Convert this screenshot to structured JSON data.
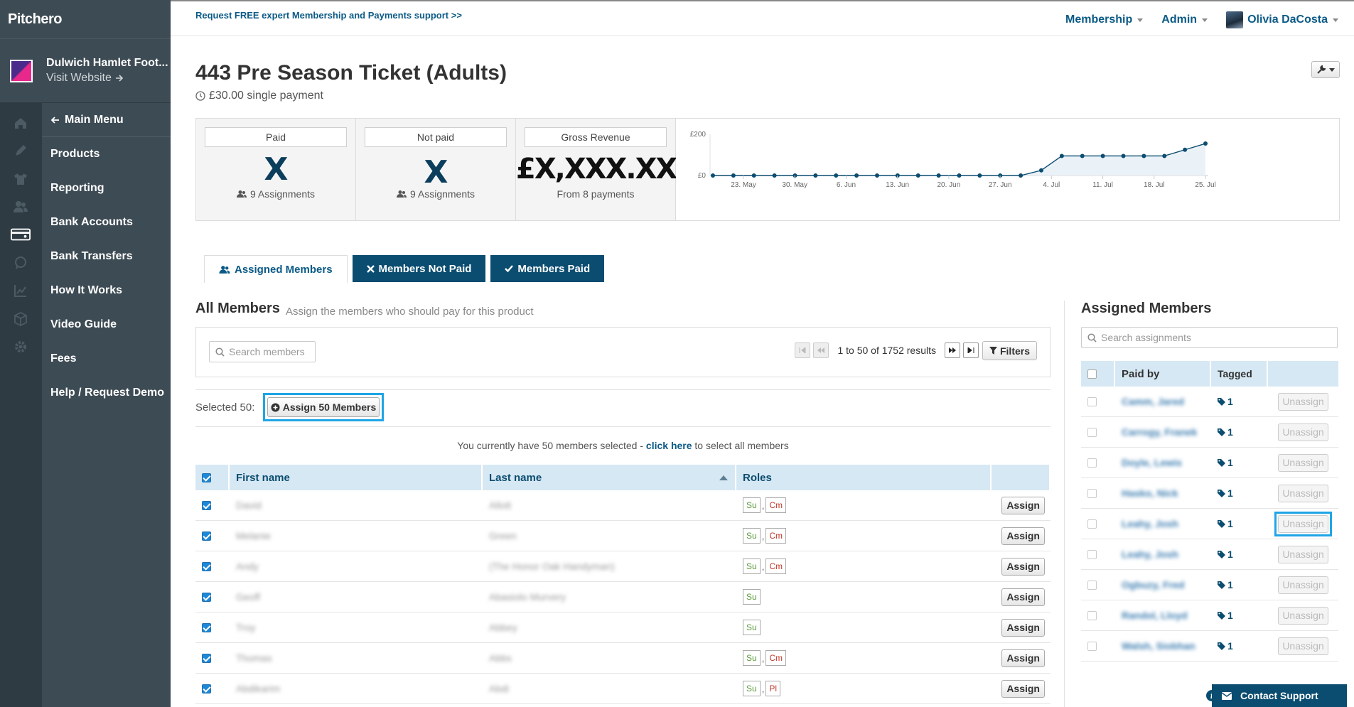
{
  "app": {
    "logo_text": "Pitchero"
  },
  "club": {
    "name": "Dulwich Hamlet Foot...",
    "visit": "Visit Website"
  },
  "nav": {
    "main_menu": "Main Menu",
    "items": [
      "Products",
      "Reporting",
      "Bank Accounts",
      "Bank Transfers",
      "How It Works",
      "Video Guide",
      "Fees",
      "Help / Request Demo"
    ]
  },
  "rail_icons": [
    "home-icon",
    "pen-icon",
    "shirt-icon",
    "users-icon",
    "card-icon",
    "chat-icon",
    "chart-icon",
    "box-icon",
    "gear-icon"
  ],
  "topbar": {
    "promo": "Request FREE expert Membership and Payments support >>",
    "membership": "Membership",
    "admin": "Admin",
    "user": "Olivia DaCosta"
  },
  "product": {
    "title": "443 Pre Season Ticket (Adults)",
    "price": "£30.00 single payment"
  },
  "stats": {
    "paid": {
      "label": "Paid",
      "value": "X",
      "sub": "9 Assignments"
    },
    "not_paid": {
      "label": "Not paid",
      "value": "X",
      "sub": "9 Assignments"
    },
    "revenue": {
      "label": "Gross Revenue",
      "value": "£X,XXX.XX",
      "sub": "From 8 payments"
    }
  },
  "chart_data": {
    "type": "area",
    "y_ticks": [
      "£0",
      "£200"
    ],
    "ylim": [
      0,
      200
    ],
    "x_ticks": [
      "23. May",
      "30. May",
      "6. Jun",
      "13. Jun",
      "20. Jun",
      "27. Jun",
      "4. Jul",
      "11. Jul",
      "18. Jul",
      "25. Jul"
    ],
    "series": [
      {
        "values": [
          0,
          0,
          0,
          0,
          0,
          0,
          0,
          0,
          0,
          0,
          0,
          0,
          0,
          0,
          0,
          0,
          25,
          95,
          95,
          95,
          95,
          95,
          95,
          125,
          155
        ]
      }
    ]
  },
  "tabs": [
    "Assigned Members",
    "Members Not Paid",
    "Members Paid"
  ],
  "all_members": {
    "title": "All Members",
    "hint": "Assign the members who should pay for this product",
    "search_placeholder": "Search members",
    "pager_text": "1 to 50 of 1752 results",
    "filters": "Filters",
    "selected_label": "Selected 50:",
    "assign_button": "Assign 50 Members",
    "notice_pre": "You currently have 50 members selected - ",
    "notice_link": "click here",
    "notice_post": " to select all members",
    "columns": {
      "first": "First name",
      "last": "Last name",
      "roles": "Roles"
    },
    "assign_label": "Assign",
    "rows": [
      {
        "first": "David",
        "last": "Allott",
        "roles": [
          {
            "code": "Su",
            "color": "green"
          },
          {
            "code": "Cm",
            "color": "red"
          }
        ]
      },
      {
        "first": "Melanie",
        "last": "Green",
        "roles": [
          {
            "code": "Su",
            "color": "green"
          },
          {
            "code": "Cm",
            "color": "red"
          }
        ]
      },
      {
        "first": "Andy",
        "last": "(The Honor Oak Handyman)",
        "roles": [
          {
            "code": "Su",
            "color": "green"
          },
          {
            "code": "Cm",
            "color": "red"
          }
        ]
      },
      {
        "first": "Geoff",
        "last": "Abasiolo Murvery",
        "roles": [
          {
            "code": "Su",
            "color": "green"
          }
        ]
      },
      {
        "first": "Troy",
        "last": "Abbey",
        "roles": [
          {
            "code": "Su",
            "color": "green"
          }
        ]
      },
      {
        "first": "Thomas",
        "last": "Abbs",
        "roles": [
          {
            "code": "Su",
            "color": "green"
          },
          {
            "code": "Cm",
            "color": "red"
          }
        ]
      },
      {
        "first": "Abdikarim",
        "last": "Abdi",
        "roles": [
          {
            "code": "Su",
            "color": "green"
          },
          {
            "code": "Pl",
            "color": "red"
          }
        ]
      }
    ]
  },
  "assigned": {
    "title": "Assigned Members",
    "search_placeholder": "Search assignments",
    "columns": {
      "paid_by": "Paid by",
      "tagged": "Tagged"
    },
    "unassign_label": "Unassign",
    "rows": [
      {
        "name": "Camm, Jared",
        "tag": "1"
      },
      {
        "name": "Carrogy, Franek",
        "tag": "1"
      },
      {
        "name": "Doyle, Lewis",
        "tag": "1"
      },
      {
        "name": "Hasko, Nick",
        "tag": "1"
      },
      {
        "name": "Leahy, Josh",
        "tag": "1"
      },
      {
        "name": "Leahy, Josh",
        "tag": "1"
      },
      {
        "name": "Ogbuzy, Fred",
        "tag": "1"
      },
      {
        "name": "Randol, Lloyd",
        "tag": "1"
      },
      {
        "name": "Walsh, Siobhan",
        "tag": "1"
      }
    ]
  },
  "support": {
    "label": "Contact Support",
    "info": "i"
  },
  "colors": {
    "sidebar": "#3d4b54",
    "rail": "#2f3b42",
    "accent": "#0b4d70",
    "link": "#0b5a86",
    "highlight": "#1ea5e6"
  }
}
